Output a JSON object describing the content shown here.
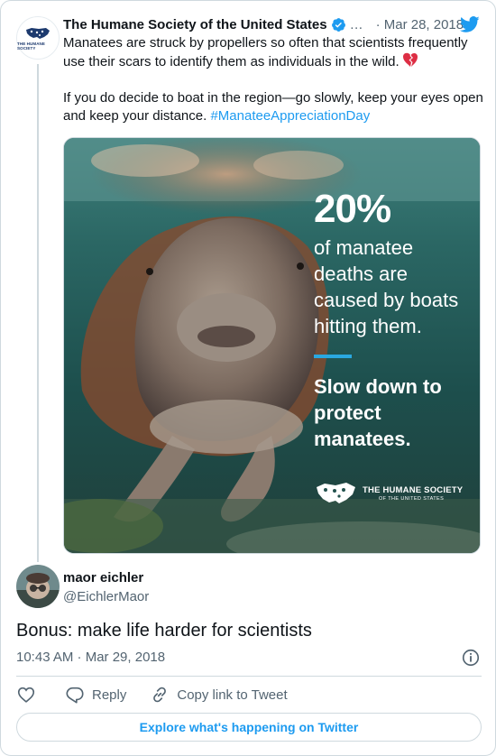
{
  "parent_tweet": {
    "author_name": "The Humane Society of the United States",
    "ellipsis": "…",
    "date": "· Mar 28, 2018",
    "avatar_logo_text": "THE HUMANE SOCIETY",
    "text_line1": "Manatees are struck by propellers so often that scientists frequently use their scars to identify them as individuals in the wild.",
    "text_line2": "If you do decide to boat in the region—go slowly, keep your eyes open and keep your distance.",
    "hashtag": "#ManateeAppreciationDay",
    "media": {
      "percent": "20%",
      "stat_text": "of manatee deaths are caused by boats hitting them.",
      "cta": "Slow down to protect manatees.",
      "logo_line1": "THE HUMANE SOCIETY",
      "logo_line2": "OF THE UNITED STATES"
    }
  },
  "reply_tweet": {
    "author_name": "maor eichler",
    "handle": "@EichlerMaor",
    "text": "Bonus: make life harder for scientists",
    "timestamp": "10:43 AM · Mar 29, 2018"
  },
  "actions": {
    "reply_label": "Reply",
    "copy_label": "Copy link to Tweet"
  },
  "explore_label": "Explore what's happening on Twitter",
  "colors": {
    "accent": "#1d9bf0",
    "text": "#0f1419",
    "secondary": "#536471",
    "border": "#cfd9de"
  },
  "icons": [
    "hsus-logo-icon",
    "verified-badge-icon",
    "twitter-bird-icon",
    "broken-heart-icon",
    "info-icon",
    "heart-icon",
    "reply-icon",
    "link-icon"
  ]
}
